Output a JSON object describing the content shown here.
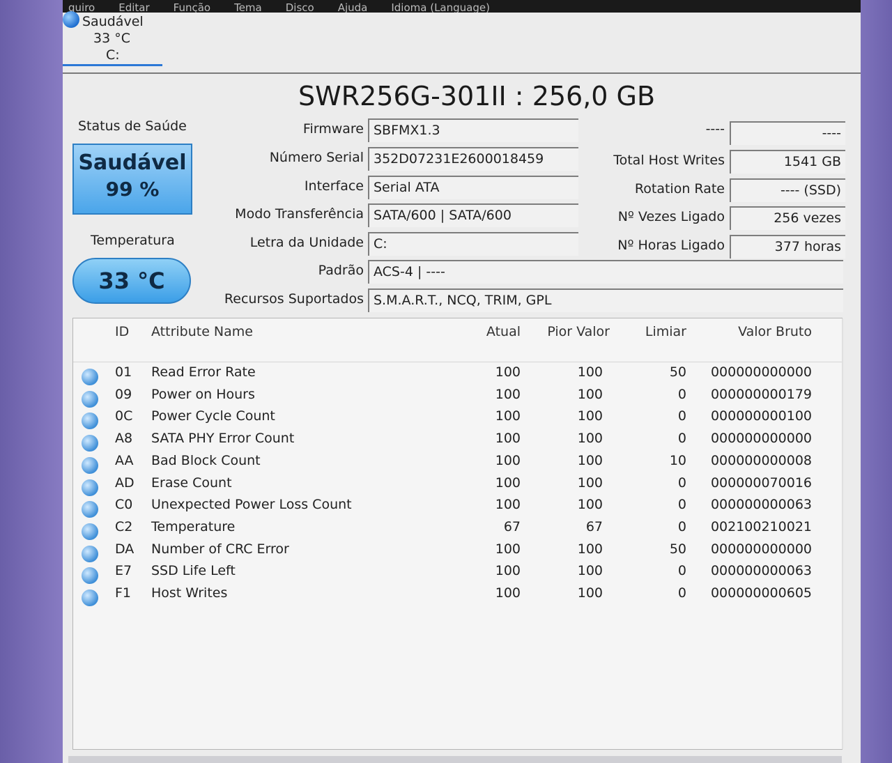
{
  "menu": [
    "quiro",
    "Editar",
    "Função",
    "Tema",
    "Disco",
    "Ajuda",
    "Idioma (Language)"
  ],
  "drive_tab": {
    "status": "Saudável",
    "temp": "33 °C",
    "letter": "C:"
  },
  "title": "SWR256G-301II : 256,0 GB",
  "health": {
    "label": "Status de Saúde",
    "status": "Saudável",
    "percent": "99 %"
  },
  "temperature": {
    "label": "Temperatura",
    "value": "33 °C"
  },
  "info": {
    "firmware_label": "Firmware",
    "firmware": "SBFMX1.3",
    "serial_label": "Número Serial",
    "serial": "352D07231E2600018459",
    "interface_label": "Interface",
    "interface": "Serial ATA",
    "transfer_label": "Modo Transferência",
    "transfer": "SATA/600 | SATA/600",
    "letter_label": "Letra da Unidade",
    "letter": "C:",
    "standard_label": "Padrão",
    "standard": "ACS-4 | ----",
    "features_label": "Recursos Suportados",
    "features": "S.M.A.R.T., NCQ, TRIM, GPL"
  },
  "right_info": {
    "blank_label": "----",
    "blank_value": "----",
    "host_writes_label": "Total Host Writes",
    "host_writes": "1541 GB",
    "rotation_label": "Rotation Rate",
    "rotation": "---- (SSD)",
    "power_count_label": "Nº Vezes Ligado",
    "power_count": "256 vezes",
    "power_hours_label": "Nº Horas Ligado",
    "power_hours": "377 horas"
  },
  "smart": {
    "headers": {
      "id": "ID",
      "name": "Attribute Name",
      "atual": "Atual",
      "pior": "Pior Valor",
      "limiar": "Limiar",
      "raw": "Valor Bruto"
    },
    "rows": [
      {
        "id": "01",
        "name": "Read Error Rate",
        "atual": "100",
        "pior": "100",
        "limiar": "50",
        "raw": "000000000000"
      },
      {
        "id": "09",
        "name": "Power on Hours",
        "atual": "100",
        "pior": "100",
        "limiar": "0",
        "raw": "000000000179"
      },
      {
        "id": "0C",
        "name": "Power Cycle Count",
        "atual": "100",
        "pior": "100",
        "limiar": "0",
        "raw": "000000000100"
      },
      {
        "id": "A8",
        "name": "SATA PHY Error Count",
        "atual": "100",
        "pior": "100",
        "limiar": "0",
        "raw": "000000000000"
      },
      {
        "id": "AA",
        "name": "Bad Block Count",
        "atual": "100",
        "pior": "100",
        "limiar": "10",
        "raw": "000000000008"
      },
      {
        "id": "AD",
        "name": "Erase Count",
        "atual": "100",
        "pior": "100",
        "limiar": "0",
        "raw": "000000070016"
      },
      {
        "id": "C0",
        "name": "Unexpected Power Loss Count",
        "atual": "100",
        "pior": "100",
        "limiar": "0",
        "raw": "000000000063"
      },
      {
        "id": "C2",
        "name": "Temperature",
        "atual": "67",
        "pior": "67",
        "limiar": "0",
        "raw": "002100210021"
      },
      {
        "id": "DA",
        "name": "Number of CRC Error",
        "atual": "100",
        "pior": "100",
        "limiar": "50",
        "raw": "000000000000"
      },
      {
        "id": "E7",
        "name": "SSD Life Left",
        "atual": "100",
        "pior": "100",
        "limiar": "0",
        "raw": "000000000063"
      },
      {
        "id": "F1",
        "name": "Host Writes",
        "atual": "100",
        "pior": "100",
        "limiar": "0",
        "raw": "000000000605"
      }
    ]
  }
}
